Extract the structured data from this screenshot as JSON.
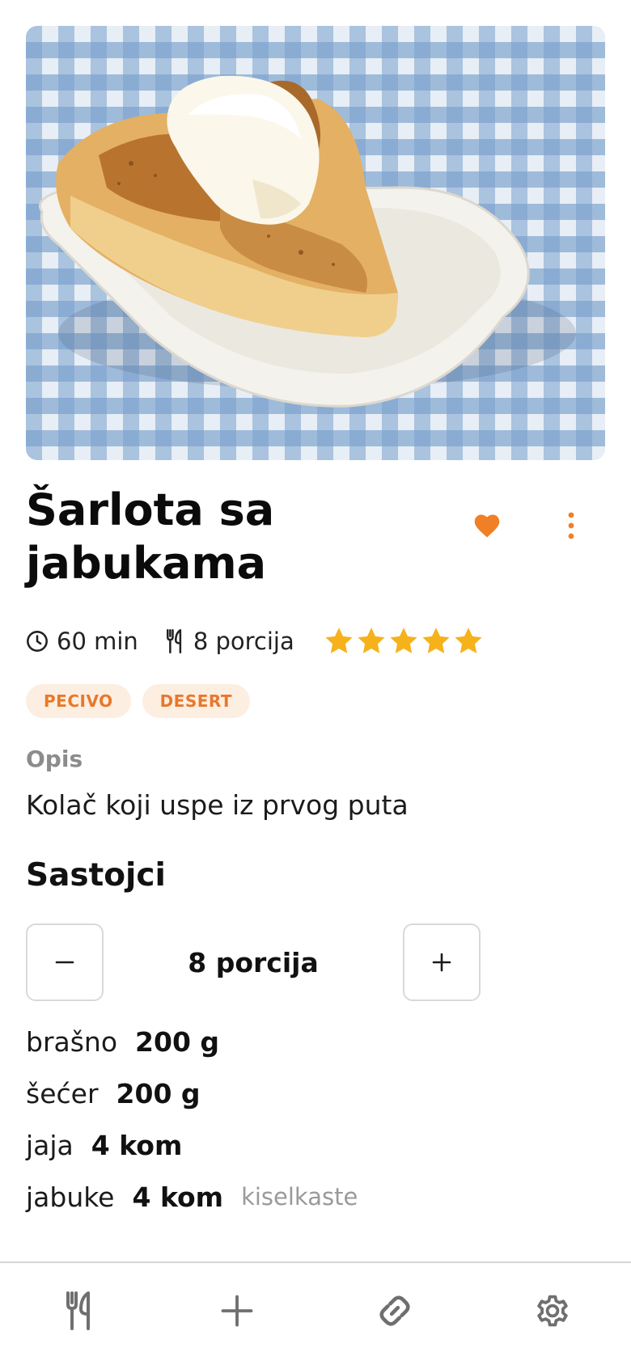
{
  "recipe": {
    "title": "Šarlota sa jabukama",
    "time": "60 min",
    "servings": "8 porcija",
    "rating": 5,
    "tags": [
      "PECIVO",
      "DESERT"
    ],
    "description_label": "Opis",
    "description": "Kolač koji uspe iz prvog puta"
  },
  "ingredients_section": {
    "title": "Sastojci",
    "stepper_value": "8 porcija",
    "items": [
      {
        "name": "brašno",
        "qty": "200 g",
        "note": ""
      },
      {
        "name": "šećer",
        "qty": "200 g",
        "note": ""
      },
      {
        "name": "jaja",
        "qty": "4 kom",
        "note": ""
      },
      {
        "name": "jabuke",
        "qty": "4 kom",
        "note": "kiselkaste"
      }
    ]
  },
  "icons": {
    "favorite": "heart-icon",
    "more": "more-vertical-icon",
    "time": "clock-icon",
    "servings": "fork-knife-icon",
    "nav": [
      "fork-knife-icon",
      "plus-icon",
      "link-icon",
      "gear-icon"
    ]
  },
  "colors": {
    "accent": "#f07f26",
    "star": "#f5b21b",
    "tag_bg": "#fdeee2",
    "nav_icon": "#6f6f6f"
  }
}
